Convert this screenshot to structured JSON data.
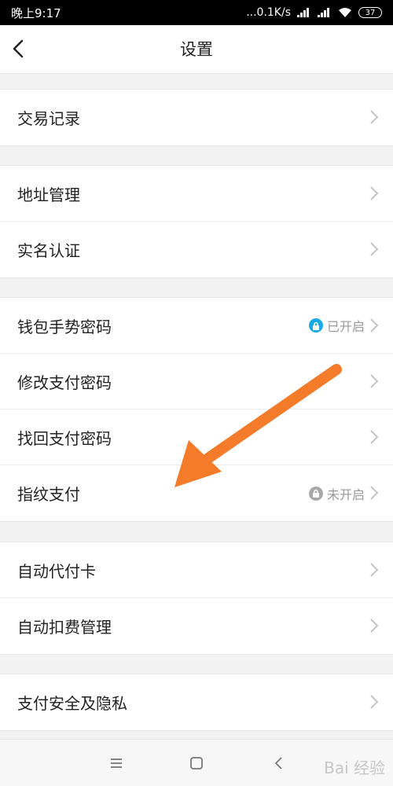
{
  "status_bar": {
    "time": "晚上9:17",
    "network_speed": "...0.1K/s",
    "battery": "37"
  },
  "header": {
    "title": "设置"
  },
  "groups": [
    {
      "rows": [
        {
          "label": "交易记录"
        }
      ]
    },
    {
      "rows": [
        {
          "label": "地址管理"
        },
        {
          "label": "实名认证"
        }
      ]
    },
    {
      "rows": [
        {
          "label": "钱包手势密码",
          "status": "已开启",
          "status_color": "#1aa8e6"
        },
        {
          "label": "修改支付密码"
        },
        {
          "label": "找回支付密码"
        },
        {
          "label": "指纹支付",
          "status": "未开启",
          "status_color": "#a8a8a8"
        }
      ]
    },
    {
      "rows": [
        {
          "label": "自动代付卡"
        },
        {
          "label": "自动扣费管理"
        }
      ]
    },
    {
      "rows": [
        {
          "label": "支付安全及隐私"
        }
      ]
    }
  ],
  "colors": {
    "accent_arrow": "#f47b29",
    "status_on": "#1aa8e6",
    "status_off": "#a8a8a8"
  },
  "watermark": "Bai 经验"
}
